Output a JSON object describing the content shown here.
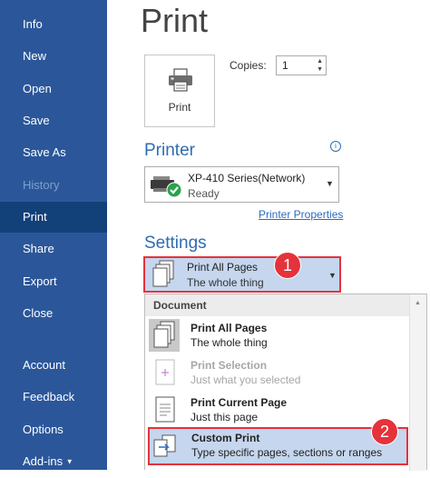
{
  "sidebar": {
    "items": [
      {
        "label": "Info"
      },
      {
        "label": "New"
      },
      {
        "label": "Open"
      },
      {
        "label": "Save"
      },
      {
        "label": "Save As"
      },
      {
        "label": "History"
      },
      {
        "label": "Print"
      },
      {
        "label": "Share"
      },
      {
        "label": "Export"
      },
      {
        "label": "Close"
      },
      {
        "label": "Account"
      },
      {
        "label": "Feedback"
      },
      {
        "label": "Options"
      },
      {
        "label": "Add-ins"
      }
    ],
    "active": "Print",
    "disabled": "History"
  },
  "main": {
    "title": "Print",
    "print_button_label": "Print",
    "copies_label": "Copies:",
    "copies_value": "1",
    "printer": {
      "heading": "Printer",
      "name": "XP-410 Series(Network)",
      "status": "Ready",
      "properties_link": "Printer Properties"
    },
    "settings": {
      "heading": "Settings",
      "selected_name": "Print All Pages",
      "selected_sub": "The whole thing",
      "badge1": "1",
      "badge2": "2",
      "dropdown": {
        "header": "Document",
        "items": [
          {
            "name": "Print All Pages",
            "sub": "The whole thing"
          },
          {
            "name": "Print Selection",
            "sub": "Just what you selected"
          },
          {
            "name": "Print Current Page",
            "sub": "Just this page"
          },
          {
            "name": "Custom Print",
            "sub": "Type specific pages, sections or ranges"
          }
        ]
      }
    }
  },
  "colors": {
    "sidebar_bg": "#2b579a",
    "sidebar_active": "#124078",
    "accent_blue": "#2f6cb0",
    "highlight_red": "#e5323b",
    "selection_bg": "#c5d6ee"
  },
  "icons": [
    "printer-icon",
    "info-icon",
    "printer-status-icon",
    "pages-icon",
    "selection-icon",
    "current-page-icon",
    "custom-print-icon",
    "chevron-down-icon"
  ]
}
